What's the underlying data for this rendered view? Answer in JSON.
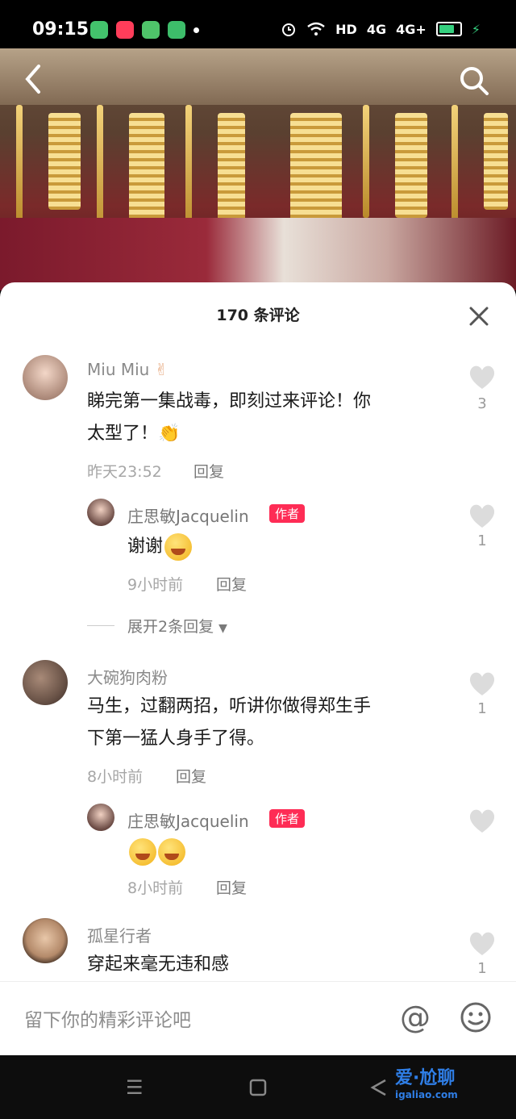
{
  "status": {
    "time": "09:15",
    "network": "HD",
    "signal_1": "4G",
    "signal_2": "4G+",
    "colors": {
      "app1": "#43c36c",
      "app2": "#ff3d5a",
      "app3": "#4fc46a",
      "app4": "#3dbd6a"
    }
  },
  "sheet": {
    "title": "170 条评论"
  },
  "comments": [
    {
      "user": "Miu Miu",
      "text_line1": "睇完第一集战毒，即刻过来评论！你",
      "text_line2": "太型了！",
      "time": "昨天23:52",
      "reply_label": "回复",
      "likes": "3",
      "reply": {
        "user": "庄思敏Jacquelin",
        "badge": "作者",
        "text": "谢谢",
        "time": "9小时前",
        "reply_label": "回复",
        "likes": "1"
      },
      "expand": "展开2条回复"
    },
    {
      "user": "大碗狗肉粉",
      "text_line1": "马生，过翻两招，听讲你做得郑生手",
      "text_line2": "下第一猛人身手了得。",
      "time": "8小时前",
      "reply_label": "回复",
      "likes": "1",
      "reply": {
        "user": "庄思敏Jacquelin",
        "badge": "作者",
        "time": "8小时前",
        "reply_label": "回复"
      }
    },
    {
      "user": "孤星行者",
      "text_line1": "穿起来毫无违和感",
      "likes": "1"
    }
  ],
  "input": {
    "placeholder": "留下你的精彩评论吧",
    "at": "@"
  },
  "watermark": {
    "line1": "爱·尬聊",
    "line2": "igaliao.com"
  }
}
